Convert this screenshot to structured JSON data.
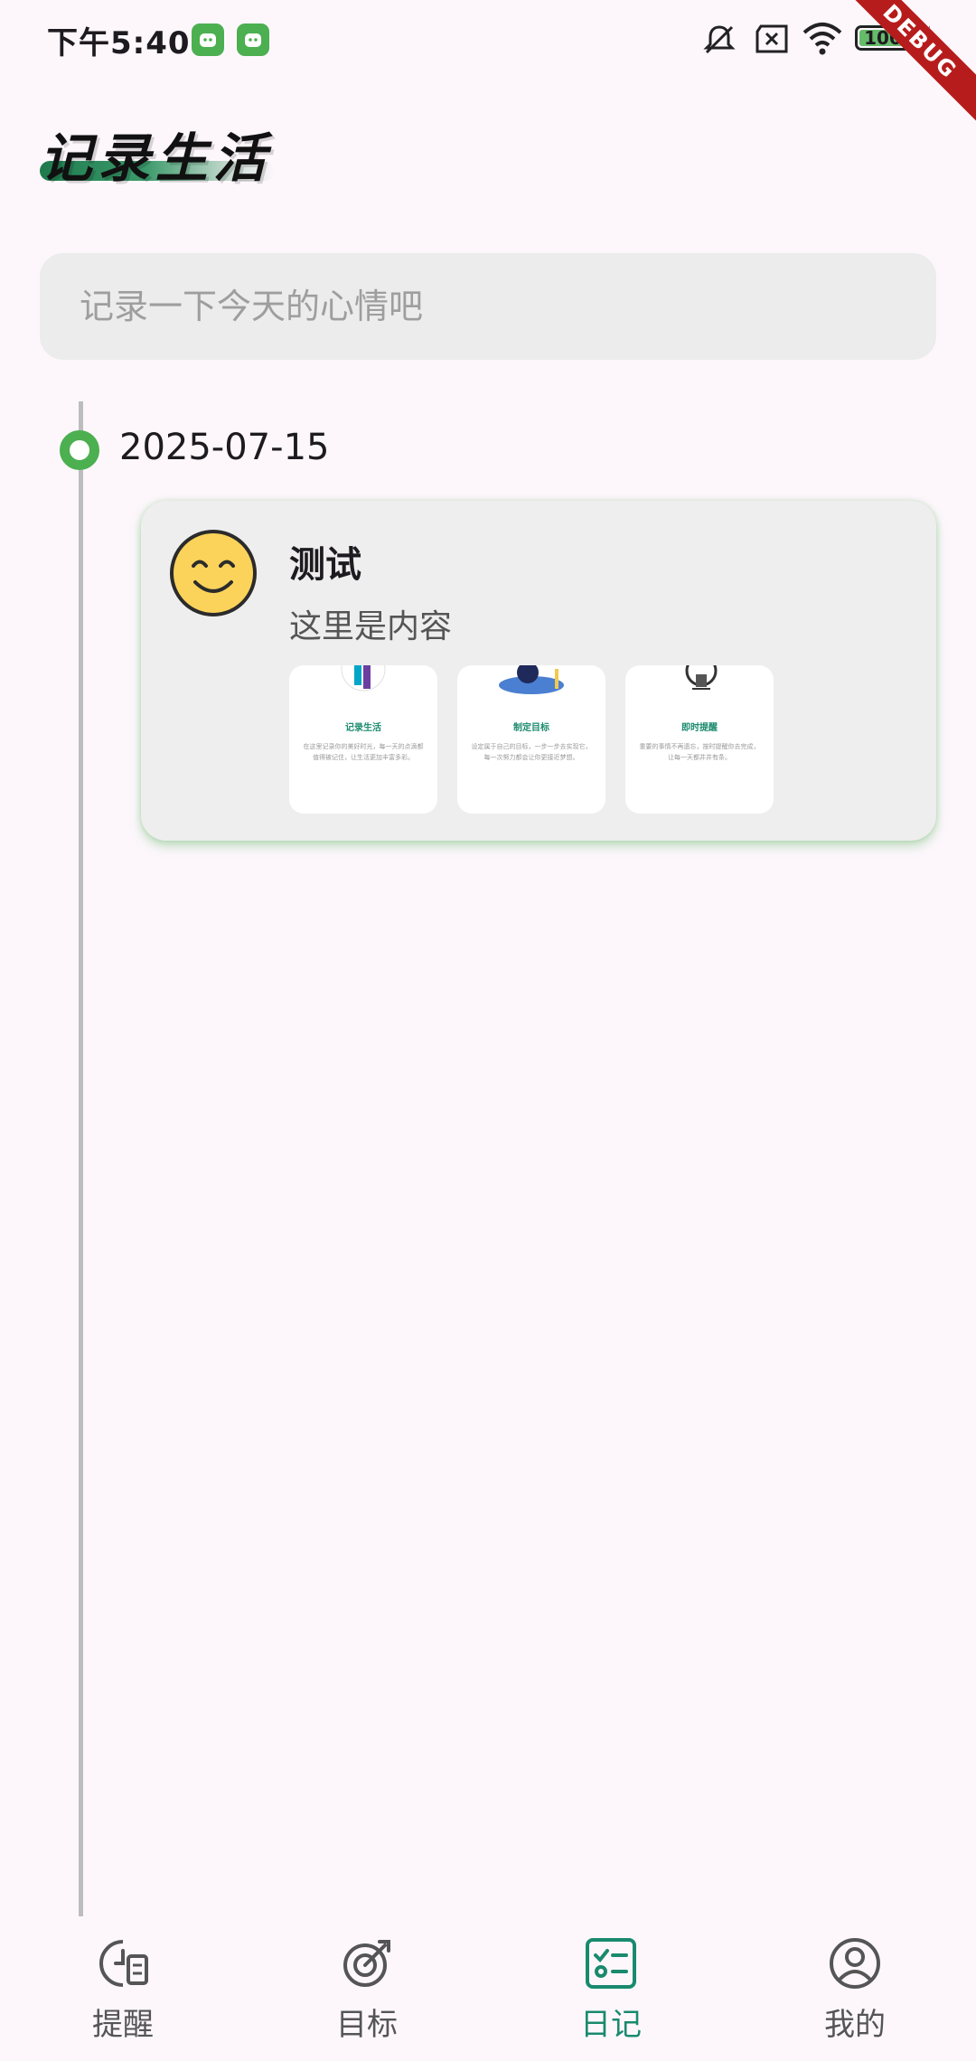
{
  "status_bar": {
    "time": "下午5:40",
    "battery": "100",
    "icons": [
      "app-notification-icon",
      "app-notification-icon",
      "mute-icon",
      "no-sim-icon",
      "wifi-icon",
      "battery-icon",
      "charging-icon"
    ]
  },
  "debug_banner": "DEBUG",
  "header": {
    "title": "记录生活"
  },
  "mood_input": {
    "placeholder": "记录一下今天的心情吧",
    "value": ""
  },
  "timeline": {
    "entries": [
      {
        "date": "2025-07-15",
        "mood_icon": "smiley-face-icon",
        "title": "测试",
        "content": "这里是内容",
        "images": [
          {
            "title": "记录生活",
            "text": "在这里记录你的美好时光，每一天的点滴都值得被记住，让生活更加丰富多彩。"
          },
          {
            "title": "制定目标",
            "text": "设定属于自己的目标，一步一步去实现它，每一次努力都会让你更接近梦想。"
          },
          {
            "title": "即时提醒",
            "text": "重要的事情不再遗忘，按时提醒你去完成，让每一天都井井有条。"
          }
        ]
      }
    ]
  },
  "bottom_nav": {
    "items": [
      {
        "label": "提醒",
        "icon": "reminder-icon",
        "active": false
      },
      {
        "label": "目标",
        "icon": "target-icon",
        "active": false
      },
      {
        "label": "日记",
        "icon": "diary-checklist-icon",
        "active": true
      },
      {
        "label": "我的",
        "icon": "profile-icon",
        "active": false
      }
    ]
  },
  "colors": {
    "background": "#fdf7fc",
    "accent_green": "#4caf50",
    "nav_active": "#1a8a6e",
    "debug_ribbon": "#b71c1c"
  }
}
